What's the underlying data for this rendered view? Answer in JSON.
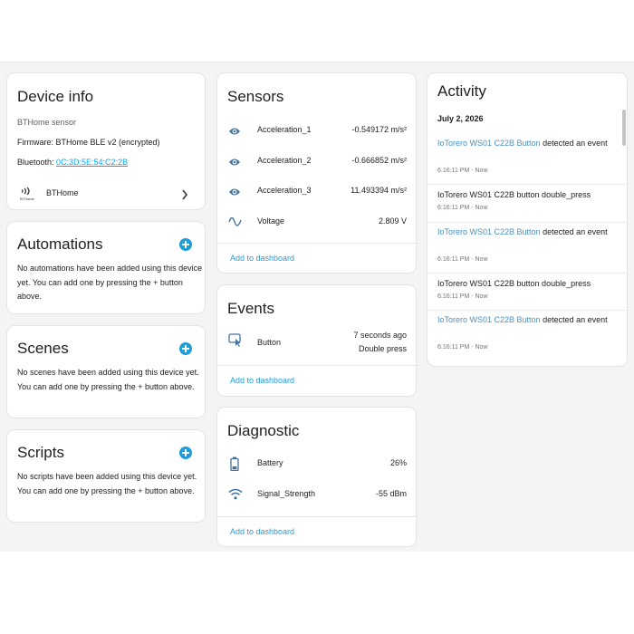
{
  "device_info": {
    "title": "Device info",
    "model": "BTHome sensor",
    "firmware": "Firmware: BTHome BLE v2 (encrypted)",
    "bluetooth_label": "Bluetooth: ",
    "bluetooth_address": "0C:3D:5E:54:C2:2B",
    "integration": "BTHome",
    "integration_logo_text": "BTHome"
  },
  "automations": {
    "title": "Automations",
    "description": "No automations have been added using this device yet. You can add one by pressing the + button above."
  },
  "scenes": {
    "title": "Scenes",
    "description": "No scenes have been added using this device yet. You can add one by pressing the + button above."
  },
  "scripts": {
    "title": "Scripts",
    "description": "No scripts have been added using this device yet. You can add one by pressing the + button above."
  },
  "sensors": {
    "title": "Sensors",
    "rows": [
      {
        "label": "Acceleration_1",
        "value": "-0.549172 m/s²",
        "icon": "eye-icon"
      },
      {
        "label": "Acceleration_2",
        "value": "-0.666852 m/s²",
        "icon": "eye-icon"
      },
      {
        "label": "Acceleration_3",
        "value": "11.493394 m/s²",
        "icon": "eye-icon"
      },
      {
        "label": "Voltage",
        "value": "2.809 V",
        "icon": "sine-wave-icon"
      }
    ],
    "add_label": "Add to dashboard"
  },
  "events": {
    "title": "Events",
    "row": {
      "label": "Button",
      "time": "7 seconds ago",
      "type": "Double press",
      "icon": "button-press-icon"
    },
    "add_label": "Add to dashboard"
  },
  "diagnostic": {
    "title": "Diagnostic",
    "rows": [
      {
        "label": "Battery",
        "value": "26%",
        "icon": "battery-icon"
      },
      {
        "label": "Signal_Strength",
        "value": "-55 dBm",
        "icon": "wifi-icon"
      }
    ],
    "add_label": "Add to dashboard"
  },
  "activity": {
    "title": "Activity",
    "date": "July 2, 2026",
    "items": [
      {
        "entity": "IoTorero WS01 C22B Button",
        "text": " detected an event",
        "time": "6:16:11 PM - Now",
        "linked": true
      },
      {
        "entity": "",
        "text": "IoTorero WS01 C22B button double_press",
        "time": "6:16:11 PM - Now",
        "linked": false
      },
      {
        "entity": "IoTorero WS01 C22B Button",
        "text": " detected an event",
        "time": "6:16:11 PM - Now",
        "linked": true
      },
      {
        "entity": "",
        "text": "IoTorero WS01 C22B button double_press",
        "time": "6:16:11 PM - Now",
        "linked": false
      },
      {
        "entity": "IoTorero WS01 C22B Button",
        "text": " detected an event",
        "time": "6:16:11 PM - Now",
        "linked": true
      }
    ]
  },
  "colors": {
    "accent": "#1e9ed8",
    "link": "#03a9f4",
    "icon": "#44739e",
    "background": "#f4f4f5"
  }
}
